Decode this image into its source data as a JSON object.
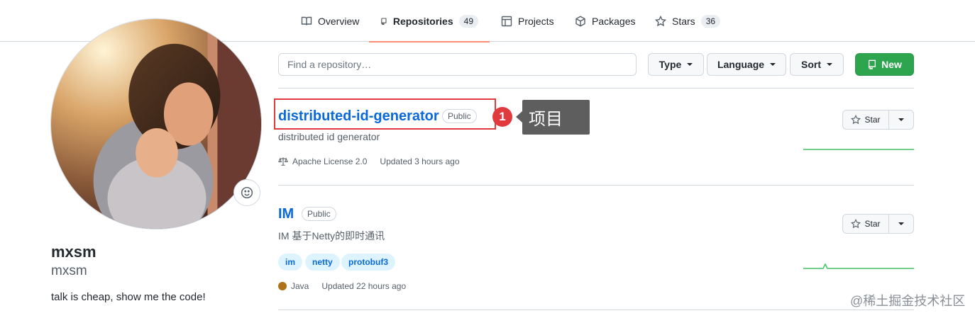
{
  "tabs": [
    {
      "label": "Overview",
      "icon": "book-icon"
    },
    {
      "label": "Repositories",
      "count": "49",
      "icon": "repo-icon",
      "active": true
    },
    {
      "label": "Projects",
      "icon": "table-icon"
    },
    {
      "label": "Packages",
      "icon": "package-icon"
    },
    {
      "label": "Stars",
      "count": "36",
      "icon": "star-icon"
    }
  ],
  "profile": {
    "name": "mxsm",
    "login": "mxsm",
    "bio": "talk is cheap, show me the code!"
  },
  "filters": {
    "search_placeholder": "Find a repository…",
    "type_label": "Type",
    "language_label": "Language",
    "sort_label": "Sort",
    "new_label": "New"
  },
  "repos": [
    {
      "name": "distributed-id-generator",
      "visibility": "Public",
      "description": "distributed id generator",
      "license": "Apache License 2.0",
      "updated": "Updated 3 hours ago",
      "star_label": "Star"
    },
    {
      "name": "IM",
      "visibility": "Public",
      "description": "IM 基于Netty的即时通讯",
      "topics": [
        "im",
        "netty",
        "protobuf3"
      ],
      "language": "Java",
      "language_color": "#b07219",
      "updated": "Updated 22 hours ago",
      "star_label": "Star"
    }
  ],
  "annotation": {
    "marker": "1",
    "callout": "项目",
    "color": "#e0393e"
  },
  "watermark": "@稀土掘金技术社区",
  "colors": {
    "link": "#0969da",
    "primary_button": "#2da44e",
    "active_tab_underline": "#fd8c73"
  }
}
